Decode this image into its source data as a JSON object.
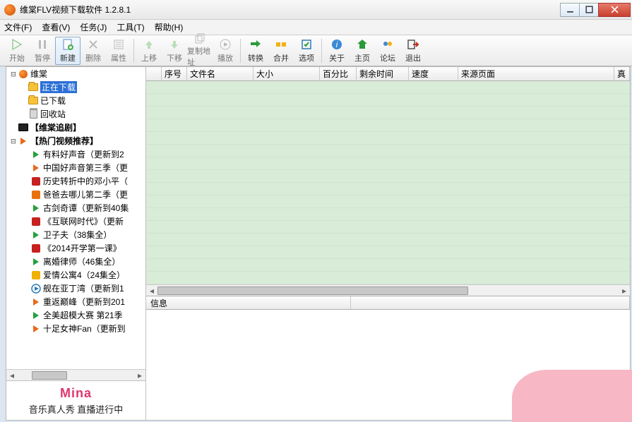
{
  "window": {
    "title": "维棠FLV视频下载软件 1.2.8.1"
  },
  "menu": {
    "file": "文件(F)",
    "view": "查看(V)",
    "task": "任务(J)",
    "tool": "工具(T)",
    "help": "帮助(H)"
  },
  "toolbar": {
    "start": "开始",
    "pause": "暂停",
    "new": "新建",
    "delete": "删除",
    "props": "属性",
    "up": "上移",
    "down": "下移",
    "copyaddr": "复制地址",
    "play": "播放",
    "convert": "转换",
    "merge": "合并",
    "options": "选项",
    "about": "关于",
    "home": "主页",
    "forum": "论坛",
    "exit": "退出"
  },
  "tree": {
    "root": "维棠",
    "downloading": "正在下载",
    "downloaded": "已下载",
    "recycle": "回收站",
    "drama": "【维棠追剧】",
    "hot": "【热门视频推荐】",
    "items": [
      "有料好声音（更新到2",
      "中国好声音第三季（更",
      "历史转折中的邓小平（",
      "爸爸去哪儿第二季（更",
      "古剑奇谭（更新到40集",
      "《互联网时代》（更新",
      "卫子夫（38集全）",
      "《2014开学第一课》",
      "离婚律师（46集全）",
      "爱情公寓4（24集全）",
      "舰在亚丁湾（更新到1",
      "重返巅峰（更新到201",
      "全美超模大赛 第21季",
      "十足女神Fan（更新到"
    ]
  },
  "grid": {
    "cols": {
      "blank": "",
      "num": "序号",
      "name": "文件名",
      "size": "大小",
      "percent": "百分比",
      "remain": "剩余时间",
      "speed": "速度",
      "source": "来源页面",
      "real": "真"
    }
  },
  "info": {
    "label": "信息"
  },
  "ad": {
    "logo": "Mina",
    "tag": "音乐真人秀 直播进行中"
  }
}
